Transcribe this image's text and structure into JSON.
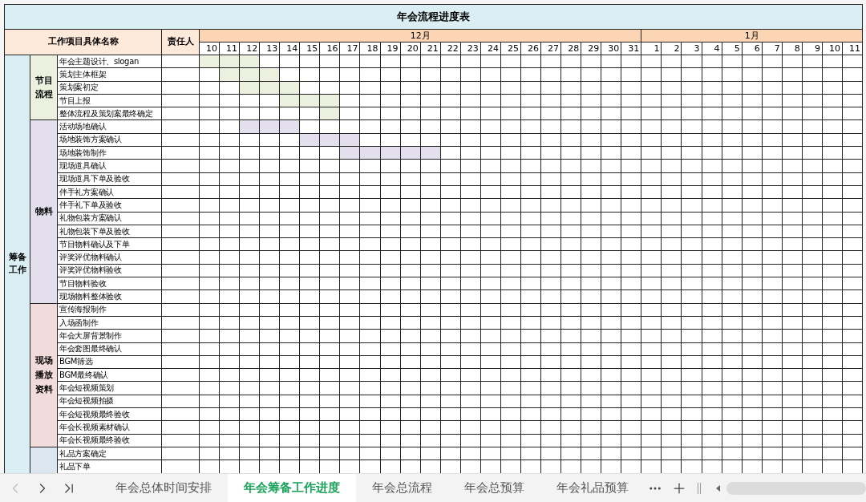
{
  "title": "年会流程进度表",
  "header": {
    "name": "工作项目具体名称",
    "person": "责任人"
  },
  "months": [
    {
      "label": "12月",
      "days": [
        "10",
        "11",
        "12",
        "13",
        "14",
        "15",
        "16",
        "17",
        "18",
        "19",
        "20",
        "21",
        "22",
        "23",
        "24",
        "25",
        "26",
        "27",
        "28",
        "29",
        "30",
        "31"
      ]
    },
    {
      "label": "1月",
      "days": [
        "1",
        "2",
        "3",
        "4",
        "5",
        "6",
        "7",
        "8",
        "9",
        "10",
        "11"
      ]
    }
  ],
  "section": {
    "label": "筹备工作",
    "color": "#daeef3"
  },
  "groups": [
    {
      "label": "节目流程",
      "color": "#ebf1de",
      "tasks": [
        {
          "name": "年会主题设计、slogan",
          "days_marked": [
            true,
            true,
            true
          ]
        },
        {
          "name": "策划主体框架",
          "days_marked": [
            false,
            true,
            true,
            true
          ]
        },
        {
          "name": "策划案初定",
          "days_marked": [
            false,
            false,
            true,
            true,
            true
          ]
        },
        {
          "name": "节目上报",
          "days_marked": [
            false,
            false,
            false,
            false,
            true,
            true,
            true
          ]
        },
        {
          "name": "整体流程及策划案最终确定",
          "days_marked": [
            false,
            false,
            false,
            false,
            false,
            false,
            true
          ]
        }
      ]
    },
    {
      "label": "物料",
      "color": "#e4dfec",
      "tasks": [
        {
          "name": "活动场地确认",
          "days_marked": [
            false,
            false,
            true,
            true,
            true
          ]
        },
        {
          "name": "场地装饰方案确认",
          "days_marked": [
            false,
            false,
            false,
            false,
            false,
            true,
            true,
            true
          ]
        },
        {
          "name": "场地装饰制作",
          "days_marked": [
            false,
            false,
            false,
            false,
            false,
            false,
            false,
            true,
            true,
            true,
            true,
            true
          ]
        },
        {
          "name": "现场道具确认"
        },
        {
          "name": "现场道具下单及验收"
        },
        {
          "name": "伴手礼方案确认"
        },
        {
          "name": "伴手礼下单及验收"
        },
        {
          "name": "礼物包装方案确认"
        },
        {
          "name": "礼物包装下单及验收"
        },
        {
          "name": "节目物料确认及下单"
        },
        {
          "name": "评奖评优物料确认"
        },
        {
          "name": "评奖评优物料验收"
        },
        {
          "name": "节目物料验收"
        },
        {
          "name": "现场物料整体验收"
        }
      ]
    },
    {
      "label": "现场播放资料",
      "color": "#f2dcdb",
      "tasks": [
        {
          "name": "宣传海报制作"
        },
        {
          "name": "入场函制作"
        },
        {
          "name": "年会大屏背景制作"
        },
        {
          "name": "年会套图最终确认"
        },
        {
          "name": "BGM筛选"
        },
        {
          "name": "BGM最终确认"
        },
        {
          "name": "年会短视频策划"
        },
        {
          "name": "年会短视频拍摄"
        },
        {
          "name": "年会短视频最终验收"
        },
        {
          "name": "年会长视频素材确认"
        },
        {
          "name": "年会长视频最终验收"
        }
      ]
    },
    {
      "color": "#dce6f1",
      "tasks": [
        {
          "name": "礼品方案确定"
        },
        {
          "name": "礼品下单"
        }
      ]
    }
  ],
  "sheet_tabs": [
    {
      "label": "年会总体时间安排",
      "selected": false
    },
    {
      "label": "年会筹备工作进度",
      "selected": true
    },
    {
      "label": "年会总流程",
      "selected": false
    },
    {
      "label": "年会总预算",
      "selected": false
    },
    {
      "label": "年会礼品预算",
      "selected": false
    }
  ]
}
